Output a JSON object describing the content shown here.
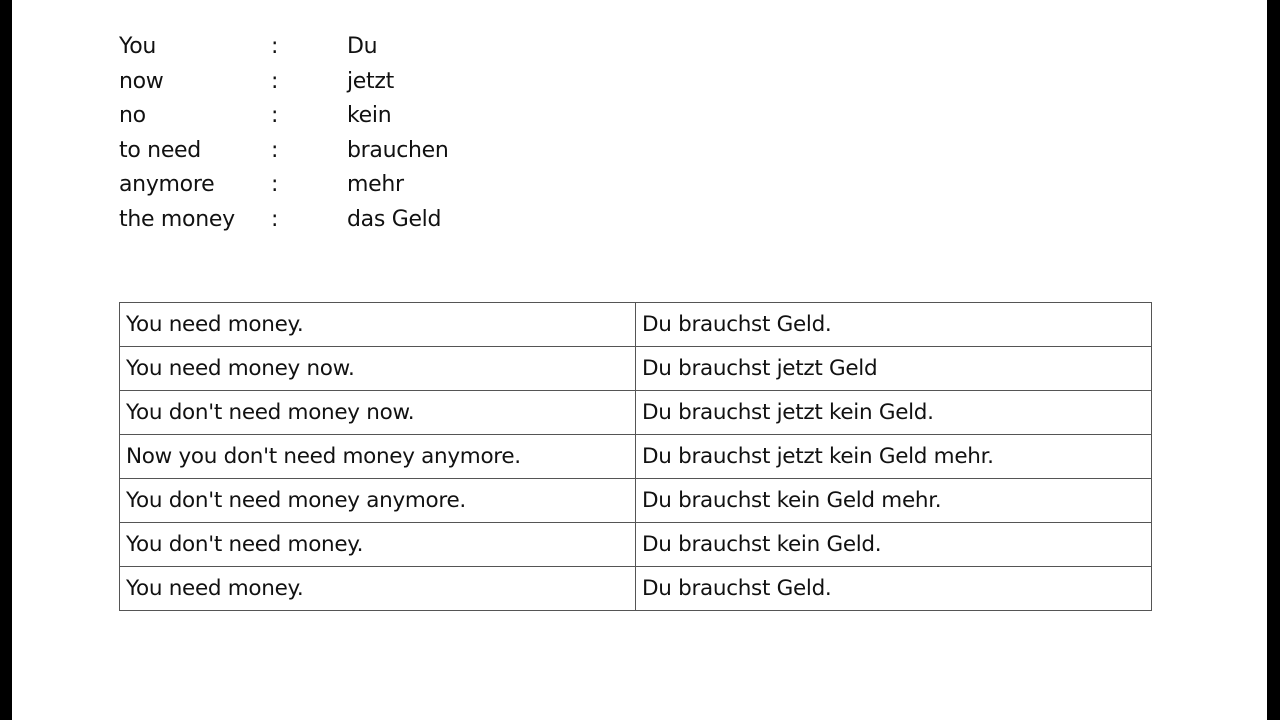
{
  "vocabulary": [
    {
      "en": "You",
      "sep": ":",
      "de": "Du"
    },
    {
      "en": "now",
      "sep": ":",
      "de": "jetzt"
    },
    {
      "en": "no",
      "sep": ":",
      "de": "kein"
    },
    {
      "en": "to need",
      "sep": ":",
      "de": "brauchen"
    },
    {
      "en": "anymore",
      "sep": ":",
      "de": "mehr"
    },
    {
      "en": "the money",
      "sep": ":",
      "de": "das Geld"
    }
  ],
  "sentences": [
    {
      "en": "You need money.",
      "de": "Du brauchst Geld."
    },
    {
      "en": "You need money now.",
      "de": "Du brauchst jetzt Geld"
    },
    {
      "en": "You don't need money now.",
      "de": "Du brauchst jetzt kein Geld."
    },
    {
      "en": "Now you don't need money anymore.",
      "de": "Du brauchst jetzt kein Geld mehr."
    },
    {
      "en": "You don't need money anymore.",
      "de": "Du brauchst kein Geld mehr."
    },
    {
      "en": "You don't need money.",
      "de": "Du brauchst kein Geld."
    },
    {
      "en": "You need money.",
      "de": "Du brauchst Geld."
    }
  ]
}
